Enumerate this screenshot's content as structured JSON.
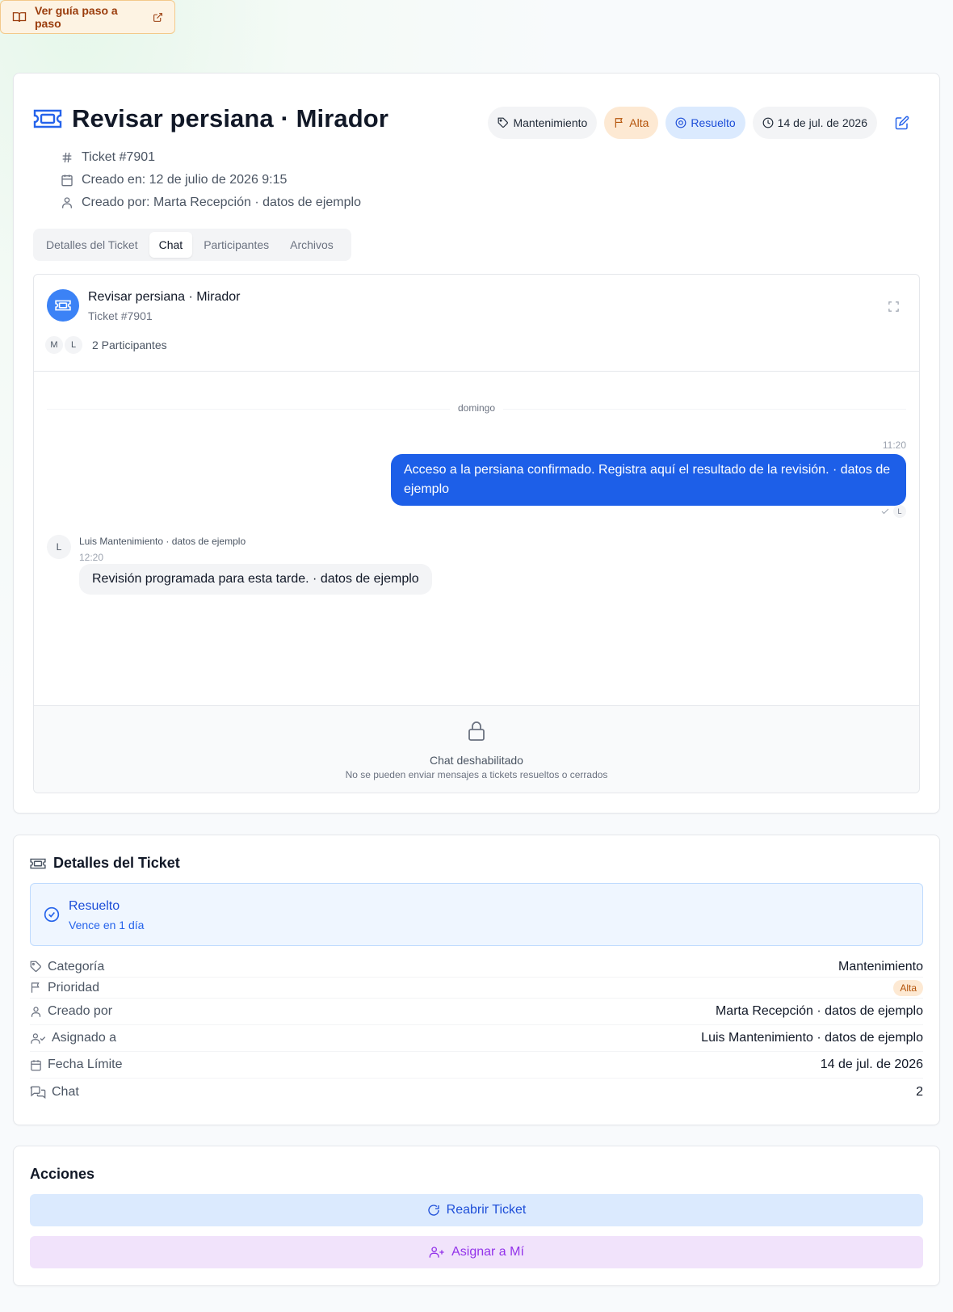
{
  "guide": {
    "label": "Ver guía paso a paso"
  },
  "ticket": {
    "title": "Revisar persiana · Mirador",
    "number": "Ticket #7901",
    "created_at": "Creado en: 12 de julio de 2026 9:15",
    "created_by": "Creado por: Marta Recepción · datos de ejemplo"
  },
  "badges": {
    "category": "Mantenimiento",
    "priority": "Alta",
    "status": "Resuelto",
    "due": "14 de jul. de 2026"
  },
  "tabs": [
    {
      "label": "Detalles del Ticket"
    },
    {
      "label": "Chat"
    },
    {
      "label": "Participantes"
    },
    {
      "label": "Archivos"
    }
  ],
  "chat": {
    "title": "Revisar persiana · Mirador",
    "subtitle": "Ticket #7901",
    "participants": [
      "M",
      "L"
    ],
    "participants_label": "2 Participantes",
    "day": "domingo",
    "outgoing": {
      "time": "11:20",
      "text": "Acceso a la persiana confirmado. Registra aquí el resultado de la revisión. · datos de ejemplo",
      "reader": "L"
    },
    "incoming": {
      "avatar": "L",
      "sender": "Luis Mantenimiento · datos de ejemplo",
      "time": "12:20",
      "text": "Revisión programada para esta tarde. · datos de ejemplo"
    },
    "disabled_title": "Chat deshabilitado",
    "disabled_sub": "No se pueden enviar mensajes a tickets resueltos o cerrados"
  },
  "details": {
    "heading": "Detalles del Ticket",
    "status_title": "Resuelto",
    "status_due": "Vence en 1 día",
    "rows": [
      {
        "label": "Categoría",
        "value": "Mantenimiento"
      },
      {
        "label": "Prioridad",
        "value": "Alta"
      },
      {
        "label": "Creado por",
        "value": "Marta Recepción · datos de ejemplo"
      },
      {
        "label": "Asignado a",
        "value": "Luis Mantenimiento · datos de ejemplo"
      },
      {
        "label": "Fecha Límite",
        "value": "14 de jul. de 2026"
      },
      {
        "label": "Chat",
        "value": "2"
      }
    ]
  },
  "actions": {
    "heading": "Acciones",
    "reopen": "Reabrir Ticket",
    "assign": "Asignar a Mí"
  },
  "colors": {
    "primary": "#2563eb",
    "bubble_out": "#1d5fe8",
    "priority_bg": "#fde9d3",
    "priority_fg": "#b45309",
    "status_bg": "#dbeafe",
    "assign_bg": "#f1e3fb",
    "assign_fg": "#9333ea"
  }
}
